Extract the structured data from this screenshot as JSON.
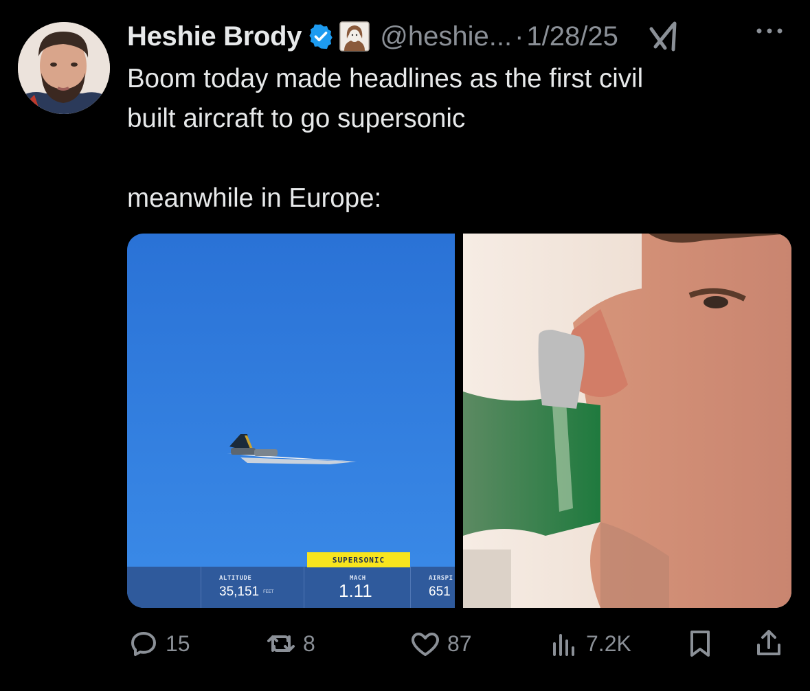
{
  "tweet": {
    "author_name": "Heshie Brody",
    "handle": "@heshie...",
    "separator": "·",
    "date": "1/28/25",
    "text": "Boom today made headlines as the first civil\nbuilt aircraft to go supersonic\n\nmeanwhile in Europe:"
  },
  "media": {
    "hud": {
      "badge": "SUPERSONIC",
      "altitude_label": "ALTITUDE",
      "altitude_value": "35,151",
      "altitude_unit": "FEET",
      "mach_label": "MACH",
      "mach_value": "1.11",
      "airspeed_label": "AIRSPI",
      "airspeed_value": "651"
    }
  },
  "actions": {
    "replies": "15",
    "reposts": "8",
    "likes": "87",
    "views": "7.2K"
  },
  "colors": {
    "background": "#000000",
    "text": "#e7e9ea",
    "muted": "#8b9097",
    "verified": "#1d9bf0",
    "sky": "#2a78dc",
    "hud_badge": "#f8e51e"
  }
}
